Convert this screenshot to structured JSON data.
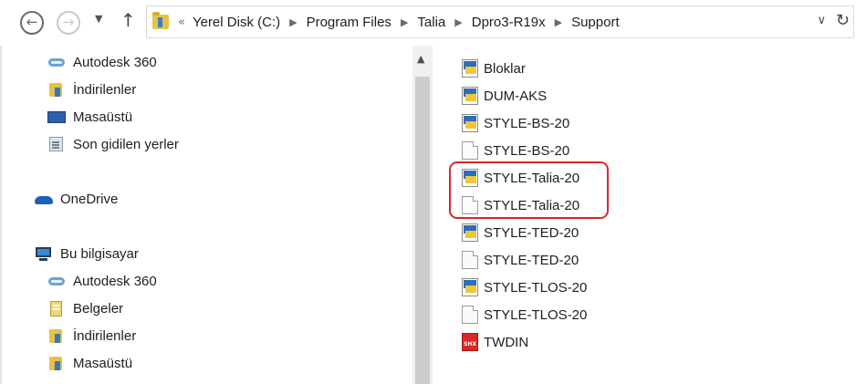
{
  "toolbar": {
    "back_glyph": "←",
    "forward_glyph": "→",
    "recent_glyph": "▼",
    "up_glyph": "↑",
    "overflow_glyph": "«",
    "dropdown_glyph": "∨",
    "refresh_glyph": "↻"
  },
  "breadcrumbs": [
    "Yerel Disk (C:)",
    "Program Files",
    "Talia",
    "Dpro3-R19x",
    "Support"
  ],
  "breadcrumb_separator": "▶",
  "nav_pane": {
    "quick": [
      {
        "label": "Autodesk 360",
        "icon": "autodesk-360-icon"
      },
      {
        "label": "İndirilenler",
        "icon": "downloads-folder-icon"
      },
      {
        "label": "Masaüstü",
        "icon": "desktop-icon"
      },
      {
        "label": "Son gidilen yerler",
        "icon": "recent-places-icon"
      }
    ],
    "onedrive": {
      "label": "OneDrive",
      "icon": "onedrive-icon"
    },
    "this_pc": {
      "label": "Bu bilgisayar",
      "icon": "computer-icon"
    },
    "pc_items": [
      {
        "label": "Autodesk 360",
        "icon": "autodesk-360-icon"
      },
      {
        "label": "Belgeler",
        "icon": "documents-folder-icon"
      },
      {
        "label": "İndirilenler",
        "icon": "downloads-folder-icon"
      },
      {
        "label": "Masaüstü",
        "icon": "desktop-icon"
      }
    ],
    "scroll_up_glyph": "▲"
  },
  "files": [
    {
      "name": "Bloklar",
      "icon": "style-file-icon"
    },
    {
      "name": "DUM-AKS",
      "icon": "style-file-icon"
    },
    {
      "name": "STYLE-BS-20",
      "icon": "style-file-icon"
    },
    {
      "name": "STYLE-BS-20",
      "icon": "blank-file-icon"
    },
    {
      "name": "STYLE-Talia-20",
      "icon": "style-file-icon"
    },
    {
      "name": "STYLE-Talia-20",
      "icon": "blank-file-icon"
    },
    {
      "name": "STYLE-TED-20",
      "icon": "style-file-icon"
    },
    {
      "name": "STYLE-TED-20",
      "icon": "blank-file-icon"
    },
    {
      "name": "STYLE-TLOS-20",
      "icon": "style-file-icon"
    },
    {
      "name": "STYLE-TLOS-20",
      "icon": "blank-file-icon"
    },
    {
      "name": "TWDIN",
      "icon": "shx-font-file-icon"
    }
  ],
  "colors": {
    "highlight": "#d9262a",
    "style_blue": "#2f6db5",
    "style_yellow": "#f2c53a",
    "shx_red": "#d62a22"
  }
}
